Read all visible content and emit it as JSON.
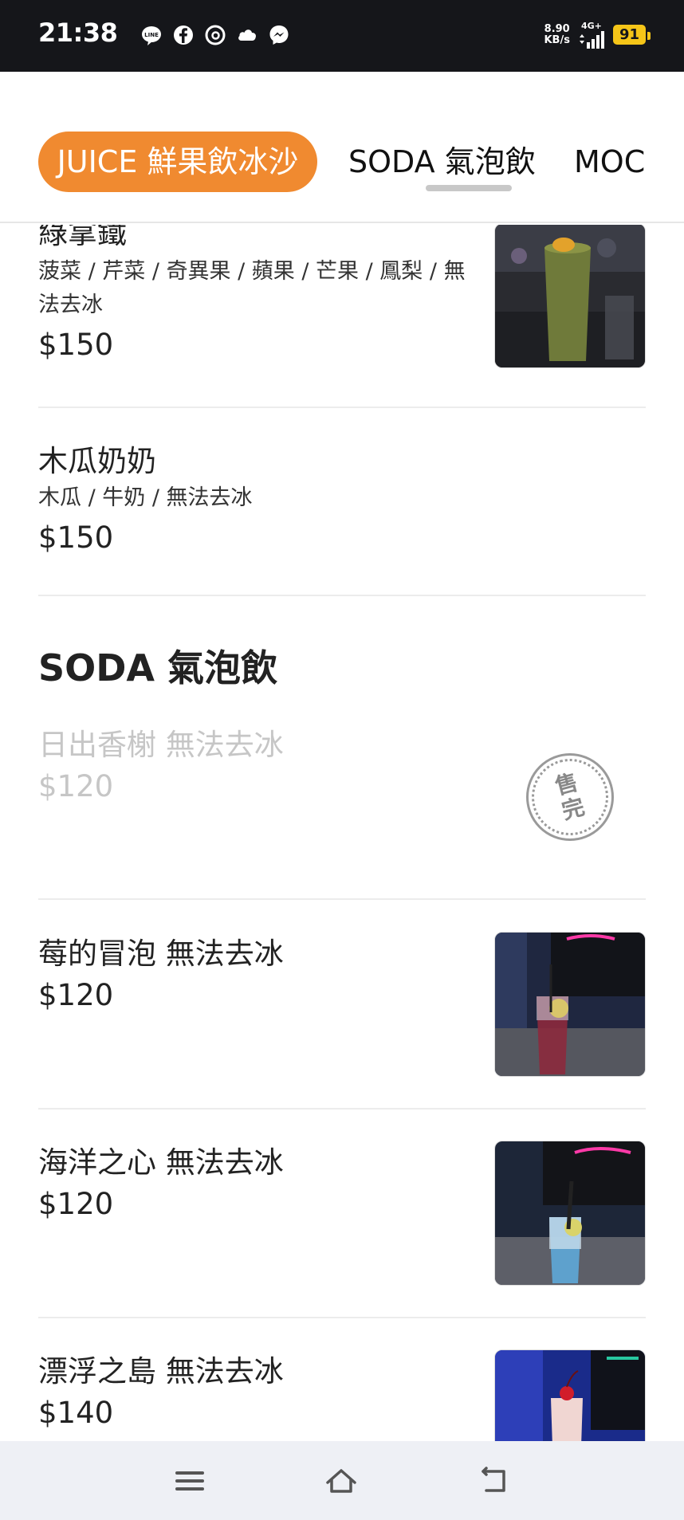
{
  "status_bar": {
    "time": "21:38",
    "speed_value": "8.90",
    "speed_unit": "KB/s",
    "network": "4G+",
    "battery": "91",
    "icons": [
      "line-icon",
      "facebook-icon",
      "threads-icon",
      "cloud-icon",
      "messenger-icon",
      "signal-icon",
      "battery-icon"
    ]
  },
  "tabs": [
    {
      "label": "JUICE 鮮果飲冰沙",
      "active": true
    },
    {
      "label": "SODA 氣泡飲",
      "active": false
    },
    {
      "label": "MOCK",
      "active": false
    }
  ],
  "items_before": [
    {
      "name": "綠拿鐵",
      "desc_line1": "菠菜 / 芹菜 / 奇異果 / 蘋果 / 芒果 / 鳳梨 / 無",
      "desc_line2": "法去冰",
      "price": "$150",
      "has_image": true
    },
    {
      "name": "木瓜奶奶",
      "desc": "木瓜 / 牛奶 / 無法去冰",
      "price": "$150",
      "has_image": false
    }
  ],
  "section_soda": {
    "title": "SODA 氣泡飲",
    "items": [
      {
        "name": "日出香榭 無法去冰",
        "price": "$120",
        "sold_out": true,
        "stamp_line1": "售",
        "stamp_line2": "完"
      },
      {
        "name": "莓的冒泡 無法去冰",
        "price": "$120",
        "sold_out": false
      },
      {
        "name": "海洋之心 無法去冰",
        "price": "$120",
        "sold_out": false
      },
      {
        "name": "漂浮之島 無法去冰",
        "price": "$140",
        "sold_out": false
      }
    ]
  },
  "colors": {
    "accent": "#f08a30",
    "status_bar_bg": "#15161a",
    "battery": "#f5c518",
    "sold_out_text": "#c6c6c6",
    "nav_bg": "#eef0f5"
  }
}
